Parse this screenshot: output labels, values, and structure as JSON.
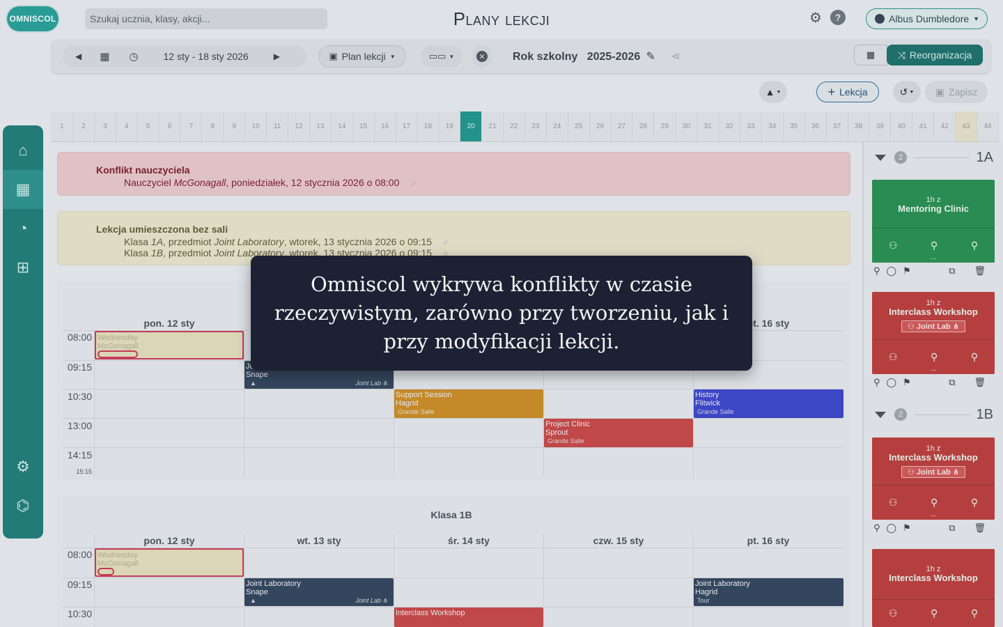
{
  "app": {
    "logo": "OMNISCOL",
    "title": "Plany lekcji"
  },
  "search": {
    "placeholder": "Szukaj ucznia, klasy, akcji..."
  },
  "user": {
    "name": "Albus Dumbledore"
  },
  "toolbar": {
    "date_range": "12 sty - 18 sty 2026",
    "plan_select": "Plan lekcji",
    "year_label": "Rok szkolny",
    "year_value": "2025-2026",
    "reorg_label": "Reorganizacja"
  },
  "actions": {
    "lekcja_label": "Lekcja",
    "zapisz_label": "Zapisz"
  },
  "weeks": [
    "1",
    "2",
    "3",
    "4",
    "5",
    "6",
    "7",
    "8",
    "9",
    "10",
    "11",
    "12",
    "13",
    "14",
    "15",
    "16",
    "17",
    "18",
    "19",
    "20",
    "21",
    "22",
    "23",
    "24",
    "25",
    "26",
    "27",
    "28",
    "29",
    "30",
    "31",
    "32",
    "33",
    "34",
    "35",
    "36",
    "37",
    "38",
    "39",
    "40",
    "41",
    "42",
    "43",
    "44"
  ],
  "current_week": "20",
  "alerts": {
    "teacher": {
      "title": "Konflikt nauczyciela",
      "line_pre": "Nauczyciel ",
      "line_em": "McGonagall",
      "line_post": ", poniedziałek, 12 stycznia 2026 o 08:00"
    },
    "room": {
      "title": "Lekcja umieszczona bez sali",
      "lines": [
        {
          "pre": "Klasa ",
          "cls": "1A",
          "mid": ", przedmiot ",
          "subj": "Joint Laboratory",
          "post": ", wtorek, 13 stycznia 2026 o 09:15"
        },
        {
          "pre": "Klasa ",
          "cls": "1B",
          "mid": ", przedmiot ",
          "subj": "Joint Laboratory",
          "post": ", wtorek, 13 stycznia 2026 o 09:15"
        }
      ]
    }
  },
  "calendar1": {
    "days": [
      "pon. 12 sty",
      "pt. 16 sty"
    ],
    "times": [
      "08:00",
      "09:15",
      "10:30",
      "13:00",
      "14:15",
      "15:15"
    ],
    "events": {
      "conflict": {
        "l1": "Wednesday",
        "l2": "McGonagall"
      },
      "joint": {
        "l1": "Jo",
        "l2": "Snape",
        "room": "Joint Lab"
      },
      "support": {
        "l1": "Support Session",
        "l2": "Hagrid",
        "room": "Grande Salle"
      },
      "project": {
        "l1": "Project Clinic",
        "l2": "Sprout",
        "room": "Grande Salle"
      },
      "history": {
        "l1": "History",
        "l2": "Flitwick",
        "room": "Grande Salle"
      }
    }
  },
  "calendar2": {
    "class_label": "Klasa 1B",
    "days": [
      "pon. 12 sty",
      "wt. 13 sty",
      "śr. 14 sty",
      "czw. 15 sty",
      "pt. 16 sty"
    ],
    "times": [
      "08:00",
      "09:15",
      "10:30"
    ],
    "events": {
      "conflict": {
        "l1": "Wednesday",
        "l2": "McGonagall"
      },
      "joint": {
        "l1": "Joint Laboratory",
        "l2": "Snape",
        "room": "Joint Lab"
      },
      "joint_fri": {
        "l1": "Joint Laboratory",
        "l2": "Hagrid",
        "room": "Tour"
      },
      "interclass": {
        "l1": "Interclass Workshop"
      }
    }
  },
  "right_panel": {
    "groups": [
      {
        "count": "2",
        "name": "1A"
      },
      {
        "count": "2",
        "name": "1B"
      }
    ],
    "cards": [
      {
        "hz": "1h z",
        "name": "Mentoring Clinic",
        "lab": "",
        "color": "#2a8c52"
      },
      {
        "hz": "1h z",
        "name": "Interclass Workshop",
        "lab": "Joint Lab",
        "color": "#b53f3f"
      },
      {
        "hz": "1h z",
        "name": "Interclass Workshop",
        "lab": "Joint Lab",
        "color": "#b53f3f"
      },
      {
        "hz": "1h z",
        "name": "Interclass Workshop",
        "lab": "",
        "color": "#b53f3f"
      }
    ],
    "dots": "..."
  },
  "overlay": {
    "text": "Omniscol wykrywa konflikty w czasie rzeczywistym, zarówno przy tworzeniu, jak i przy modyfikacji lekcji."
  }
}
